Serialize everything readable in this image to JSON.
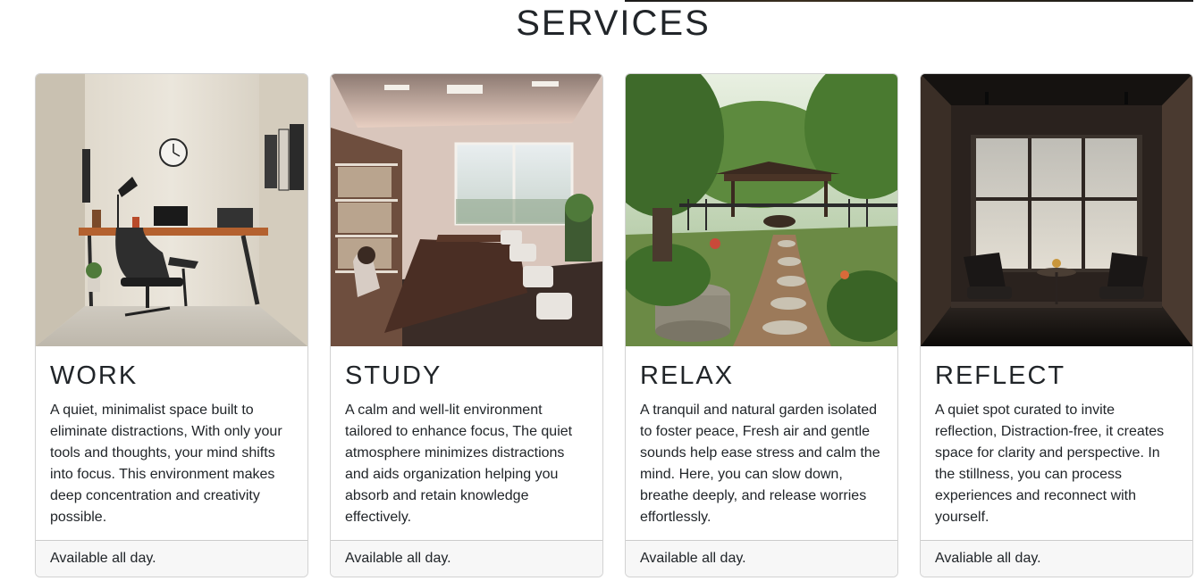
{
  "section": {
    "title": "SERVICES"
  },
  "cards": [
    {
      "title": "WORK",
      "text": "A quiet, minimalist space built to eliminate distractions, With only your tools and thoughts, your mind shifts into focus. This environment makes deep concentration and creativity possible.",
      "footer": "Available all day.",
      "image": "work-room-photo"
    },
    {
      "title": "STUDY",
      "text": "A calm and well-lit environment tailored to enhance focus, The quiet atmosphere minimizes distractions and aids organization helping you absorb and retain knowledge effectively.",
      "footer": "Available all day.",
      "image": "study-room-photo"
    },
    {
      "title": "RELAX",
      "text": "A tranquil and natural garden isolated to foster peace, Fresh air and gentle sounds help ease stress and calm the mind. Here, you can slow down, breathe deeply, and release worries effortlessly.",
      "footer": "Available all day.",
      "image": "garden-photo"
    },
    {
      "title": "REFLECT",
      "text": "A quiet spot curated to invite reflection, Distraction-free, it creates space for clarity and perspective. In the stillness, you can process experiences and reconnect with yourself.",
      "footer": "Avaliable all day.",
      "image": "reflection-room-photo"
    }
  ]
}
